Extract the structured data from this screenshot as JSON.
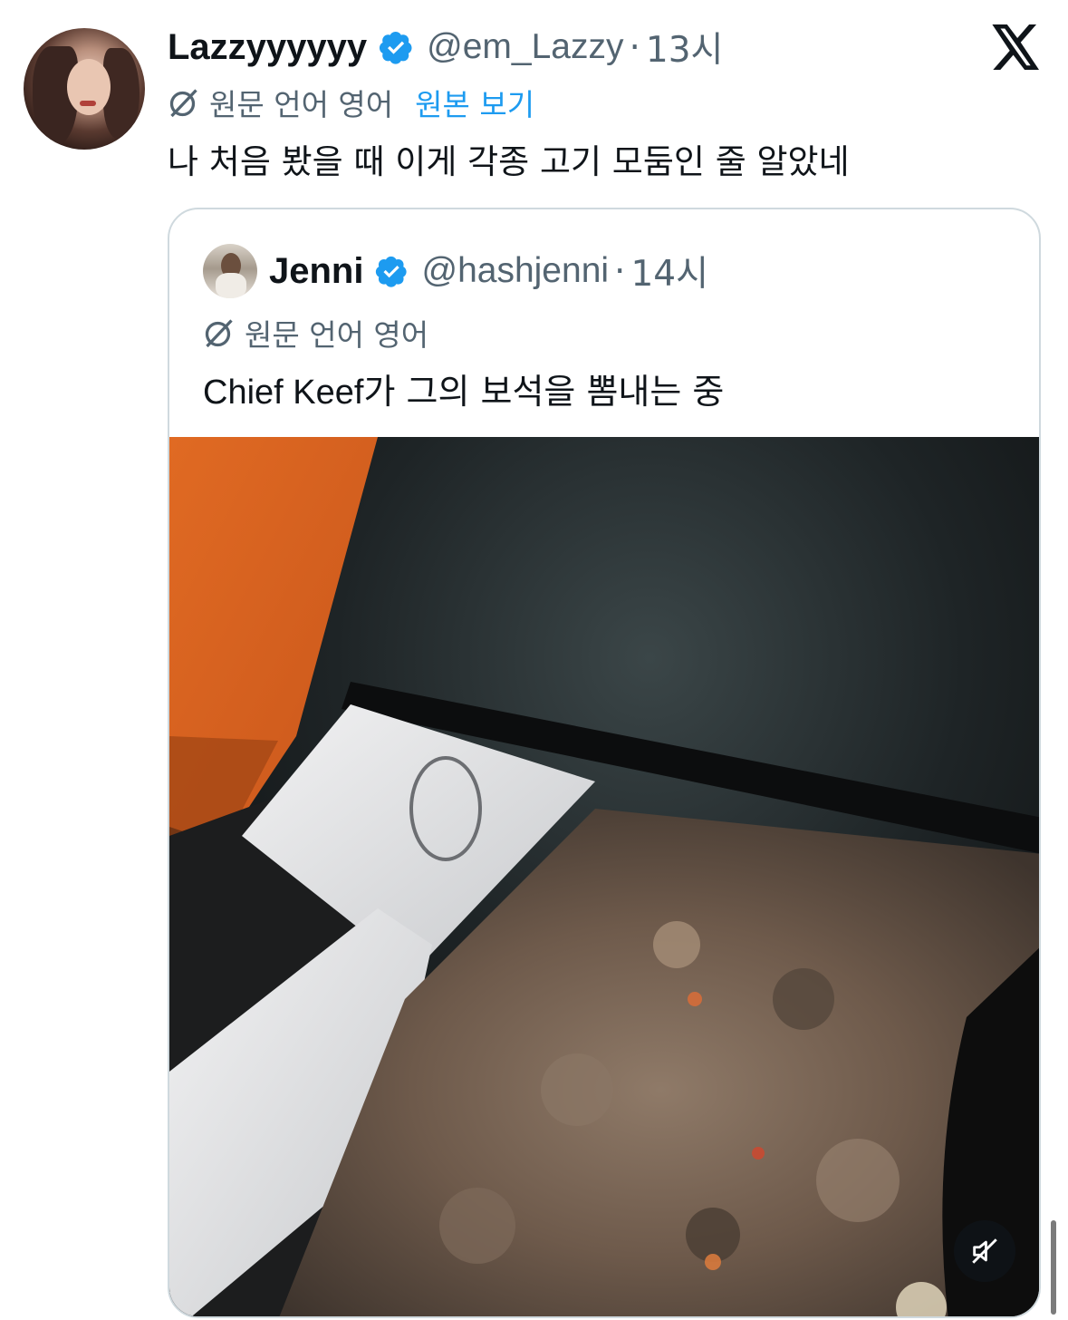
{
  "post": {
    "display_name": "Lazzyyyyyy",
    "handle": "@em_Lazzy",
    "time": "13시",
    "translation_note": "원문 언어 영어",
    "show_original": "원본 보기",
    "text": "나 처음 봤을 때 이게 각종 고기 모둠인 줄 알았네"
  },
  "quoted": {
    "display_name": "Jenni",
    "handle": "@hashjenni",
    "time": "14시",
    "translation_note": "원문 언어 영어",
    "text_latin": "Chief Keef",
    "text_rest": "가 그의 보석을 뽐내는 중"
  },
  "separator": "·",
  "icons": {
    "verified": "verified-badge-icon",
    "translate": "translate-icon",
    "logo": "x-logo-icon",
    "mute": "muted-speaker-icon"
  },
  "colors": {
    "verified": "#1d9bf0",
    "link": "#1d9bf0",
    "secondary_text": "#536471"
  }
}
